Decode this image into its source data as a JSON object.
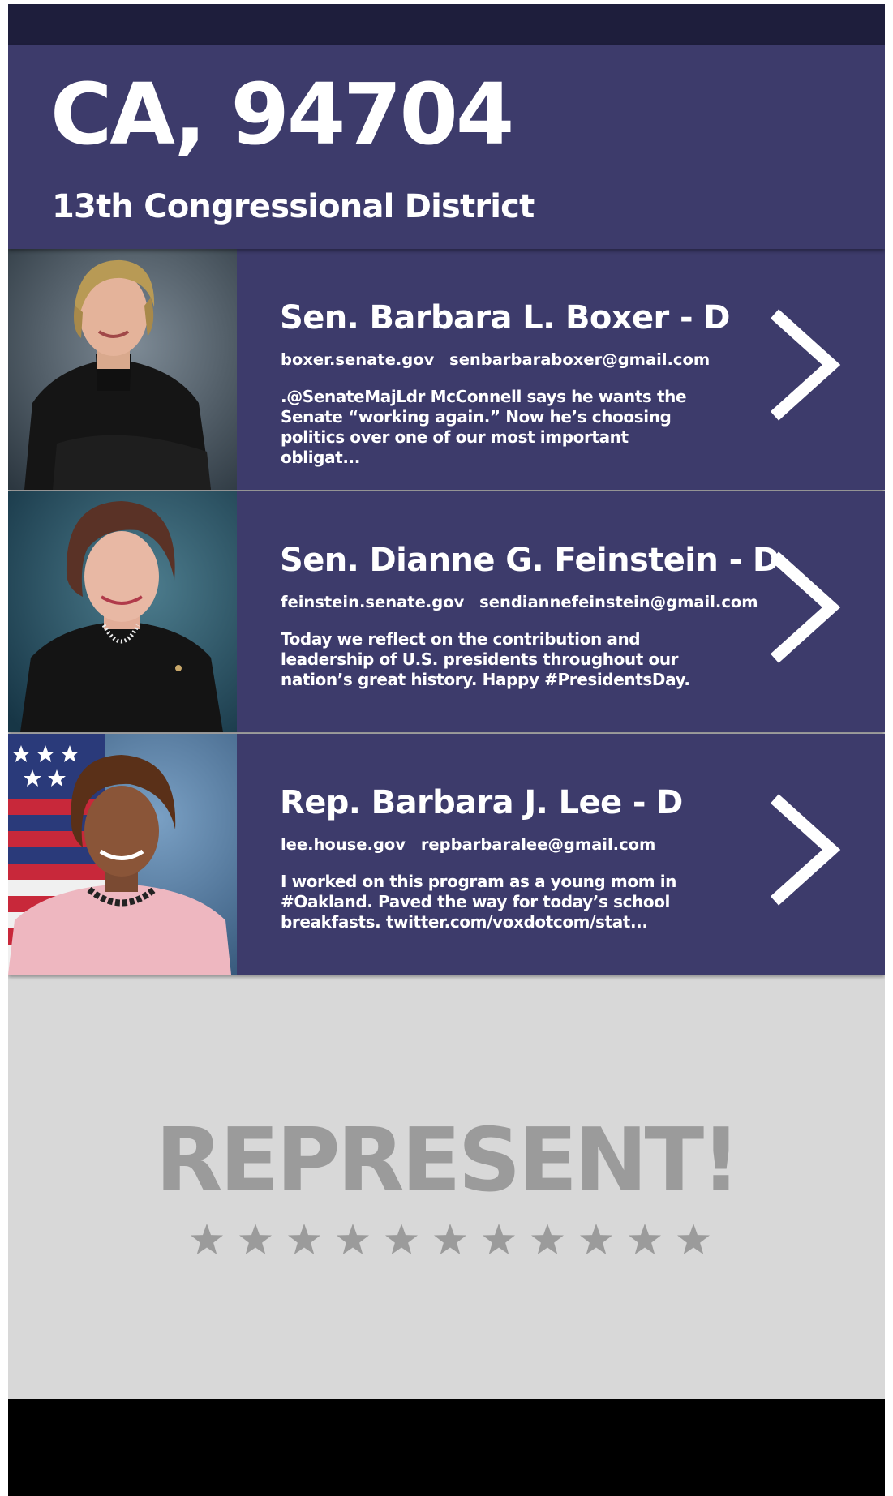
{
  "header": {
    "location": "CA, 94704",
    "district": "13th Congressional District"
  },
  "representatives": [
    {
      "name": "Sen. Barbara L. Boxer - D",
      "website": "boxer.senate.gov",
      "email": "senbarbaraboxer@gmail.com",
      "tweet": ".@SenateMajLdr McConnell says he wants the Senate “working again.” Now he’s choosing politics over one of our most important obligat..."
    },
    {
      "name": "Sen. Dianne G. Feinstein - D",
      "website": "feinstein.senate.gov",
      "email": "sendiannefeinstein@gmail.com",
      "tweet": "Today we reflect on the contribution and leadership of U.S. presidents throughout our nation’s great history. Happy #PresidentsDay."
    },
    {
      "name": "Rep. Barbara J. Lee - D",
      "website": "lee.house.gov",
      "email": "repbarbaralee@gmail.com",
      "tweet": "I worked on this program as a young mom in #Oakland. Paved the way for today’s school breakfasts. twitter.com/voxdotcom/stat..."
    }
  ],
  "footer": {
    "logo_text": "REPRESENT!",
    "star_count": 11
  },
  "colors": {
    "card_background": "#3d3b6b",
    "status_bar": "#1e1e3c",
    "footer_background": "#d8d8d8",
    "logo_gray": "#9b9b9b"
  },
  "icons": {
    "chevron": "chevron-right-icon",
    "star": "star-icon"
  }
}
